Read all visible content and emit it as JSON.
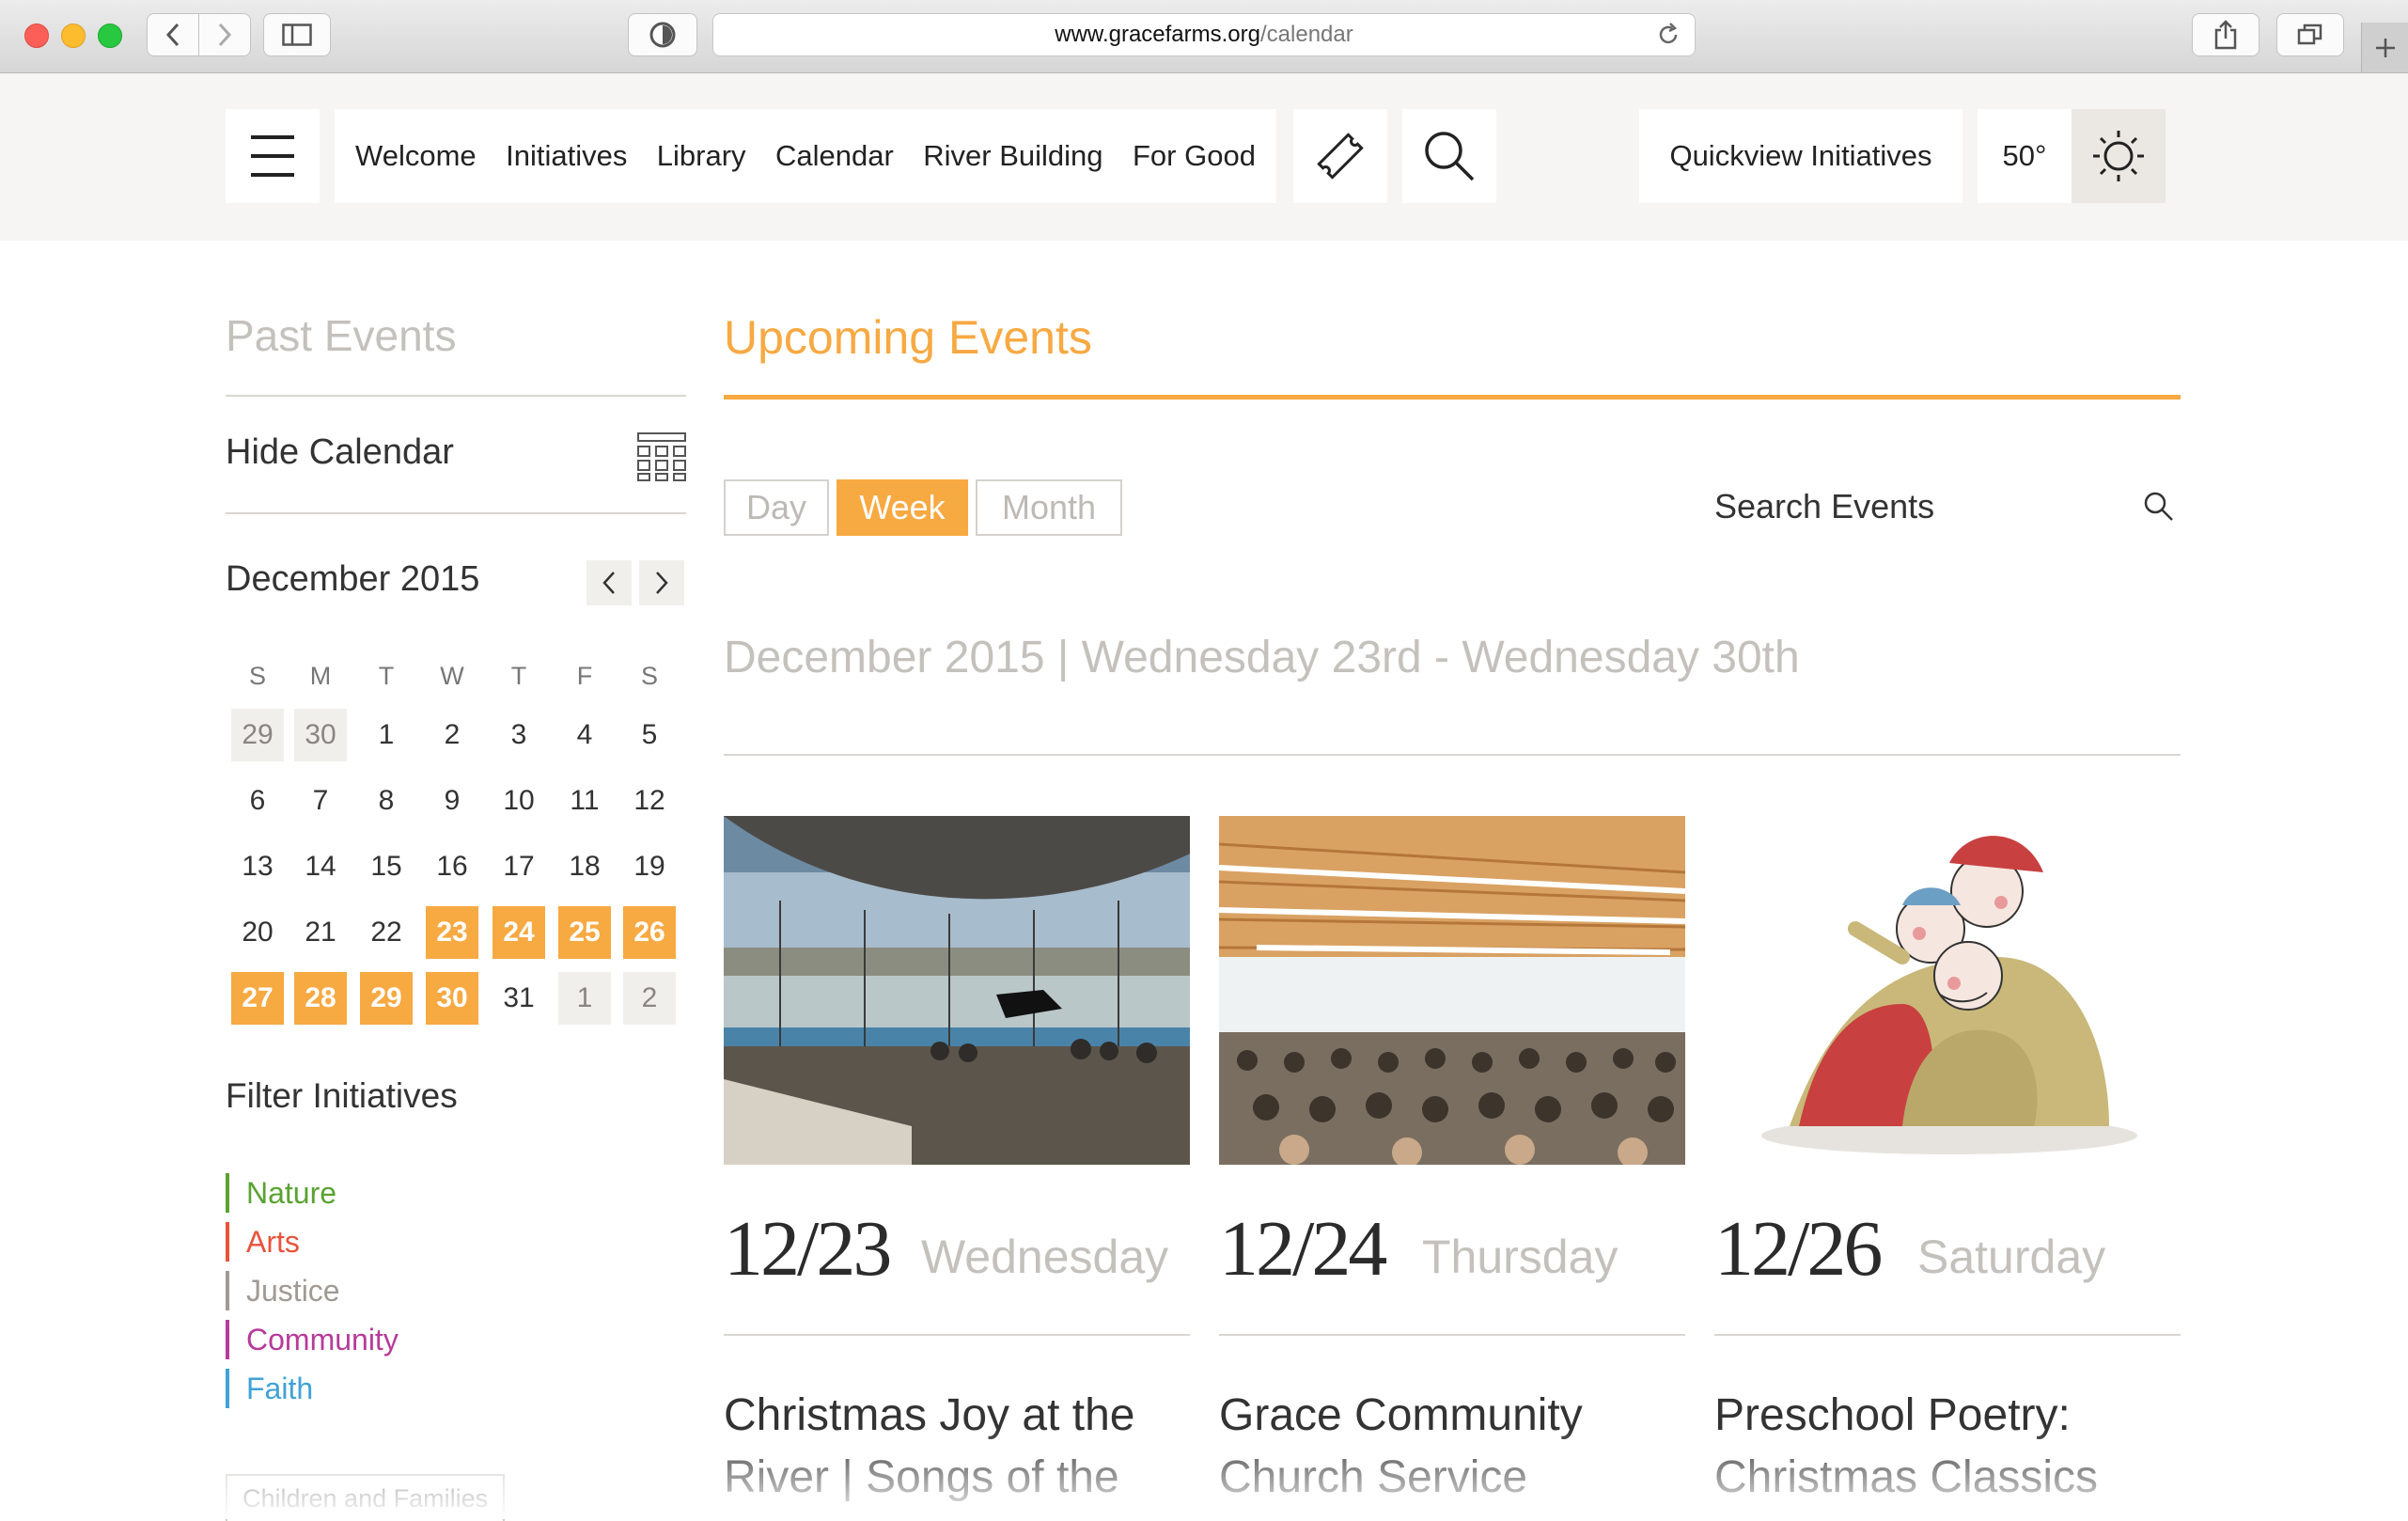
{
  "browser": {
    "url_host": "www.gracefarms.org",
    "url_path": "/calendar"
  },
  "nav": {
    "links": [
      "Welcome",
      "Initiatives",
      "Library",
      "Calendar",
      "River Building",
      "For Good"
    ],
    "quickview": "Quickview Initiatives",
    "temperature": "50°"
  },
  "sidebar": {
    "past_events": "Past Events",
    "hide_calendar": "Hide Calendar",
    "month": "December 2015",
    "weekdays": [
      "S",
      "M",
      "T",
      "W",
      "T",
      "F",
      "S"
    ],
    "weeks": [
      [
        "29",
        "30",
        "1",
        "2",
        "3",
        "4",
        "5"
      ],
      [
        "6",
        "7",
        "8",
        "9",
        "10",
        "11",
        "12"
      ],
      [
        "13",
        "14",
        "15",
        "16",
        "17",
        "18",
        "19"
      ],
      [
        "20",
        "21",
        "22",
        "23",
        "24",
        "25",
        "26"
      ],
      [
        "27",
        "28",
        "29",
        "30",
        "31",
        "1",
        "2"
      ]
    ],
    "filter_title": "Filter Initiatives",
    "filters": [
      {
        "label": "Nature",
        "color": "#5aa232"
      },
      {
        "label": "Arts",
        "color": "#e8533c"
      },
      {
        "label": "Justice",
        "color": "#a09a93"
      },
      {
        "label": "Community",
        "color": "#b63b9a"
      },
      {
        "label": "Faith",
        "color": "#3fa2d6"
      }
    ],
    "tag": "Children and Families"
  },
  "main": {
    "heading": "Upcoming Events",
    "views": [
      "Day",
      "Week",
      "Month"
    ],
    "active_view": "Week",
    "search_label": "Search Events",
    "range": "December 2015 | Wednesday 23rd - Wednesday 30th",
    "events": [
      {
        "date": "12/23",
        "dow": "Wednesday",
        "title": "Christmas Joy at the River | Songs of the"
      },
      {
        "date": "12/24",
        "dow": "Thursday",
        "title": "Grace Community Church Service"
      },
      {
        "date": "12/26",
        "dow": "Saturday",
        "title": "Preschool Poetry: Christmas Classics"
      }
    ]
  },
  "colors": {
    "accent": "#f7a942",
    "muted_text": "#c4c1bd"
  }
}
